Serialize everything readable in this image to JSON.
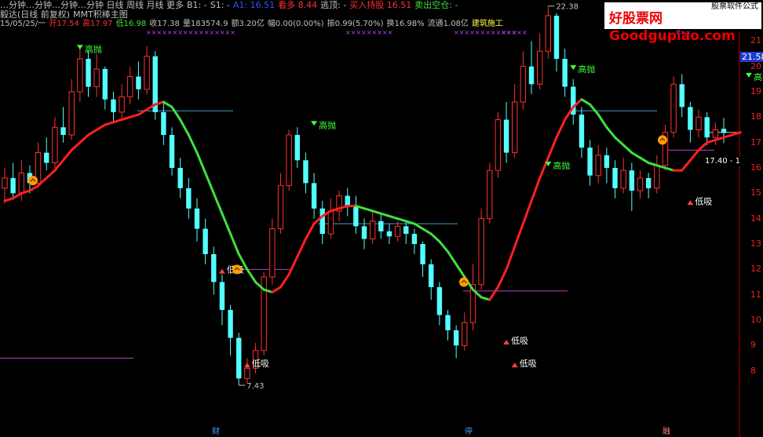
{
  "header": {
    "line1": [
      {
        "text": "…分钟…分钟…分钟…分钟 日线 周线 月线 更多",
        "color": "#c0c0c0"
      },
      {
        "text": "B1: -",
        "color": "#c0c0c0"
      },
      {
        "text": "S1: -",
        "color": "#c0c0c0"
      },
      {
        "text": "A1: 16.51",
        "color": "#3050ff"
      },
      {
        "text": "看多  8.44",
        "color": "#ff3030"
      },
      {
        "text": "逃顶: -",
        "color": "#c0c0c0"
      },
      {
        "text": "买入持股  16.51",
        "color": "#ff3030"
      },
      {
        "text": "卖出空仓: -",
        "color": "#40e040"
      }
    ],
    "title_line": [
      {
        "text": "毅达(日线 前复权)",
        "color": "#c0c0c0"
      },
      {
        "text": "MMT积棒主图",
        "color": "#c0c0c0"
      }
    ],
    "info_line": [
      {
        "text": "15/05/25/一",
        "color": "#c0c0c0"
      },
      {
        "text": "开17.54",
        "color": "#ff3030"
      },
      {
        "text": "高17.97",
        "color": "#ff3030"
      },
      {
        "text": "低16.98",
        "color": "#40e040"
      },
      {
        "text": "收17.38",
        "color": "#c0c0c0"
      },
      {
        "text": "量183574.9",
        "color": "#c0c0c0"
      },
      {
        "text": "额3.20亿",
        "color": "#c0c0c0"
      },
      {
        "text": "幅0.00(0.00%)",
        "color": "#c0c0c0"
      },
      {
        "text": "振0.99(5.70%)",
        "color": "#c0c0c0"
      },
      {
        "text": "换16.98%",
        "color": "#c0c0c0"
      },
      {
        "text": "流通1.08亿",
        "color": "#c0c0c0"
      },
      {
        "text": "建筑施工",
        "color": "#ffff40"
      }
    ],
    "x_marks": [
      "×××××××××××××××××",
      "×××××××××",
      "××××××××××××",
      "×××××",
      "×××"
    ]
  },
  "watermark": {
    "main": "好股票网Goodgupiao.com",
    "sub": "股票软件公式"
  },
  "axis": {
    "price_box": "21.58",
    "ticks": [
      "21",
      "20",
      "19",
      "18",
      "17",
      "16",
      "15",
      "14",
      "13",
      "12",
      "11",
      "10",
      "9",
      "8"
    ]
  },
  "current_price_label": "17.40 - 1",
  "annotations": {
    "high": "22.38",
    "low": "7.43",
    "gaopao": "高抛",
    "dixi": "低吸"
  },
  "bottom_tags": [
    "财",
    "停",
    "融"
  ],
  "colors": {
    "up": "#ff3030",
    "down": "#54ffff",
    "ma_up": "#ff2020",
    "ma_down": "#40e040",
    "level_cyan": "#40a0c0",
    "level_magenta": "#c040c0",
    "axis": "#c00000"
  },
  "chart_data": {
    "type": "candlestick",
    "ylim": [
      7,
      22
    ],
    "labeled_extremes": {
      "high": 22.38,
      "low": 7.43
    },
    "candles": [
      {
        "o": 15.2,
        "c": 15.6,
        "h": 16.0,
        "l": 14.6
      },
      {
        "o": 15.6,
        "c": 15.0,
        "h": 16.2,
        "l": 14.8
      },
      {
        "o": 15.0,
        "c": 15.8,
        "h": 16.3,
        "l": 14.7
      },
      {
        "o": 15.8,
        "c": 15.4,
        "h": 16.1,
        "l": 15.0
      },
      {
        "o": 15.4,
        "c": 16.6,
        "h": 17.0,
        "l": 15.2
      },
      {
        "o": 16.6,
        "c": 16.2,
        "h": 17.2,
        "l": 15.9
      },
      {
        "o": 16.2,
        "c": 17.6,
        "h": 18.0,
        "l": 16.0
      },
      {
        "o": 17.6,
        "c": 17.3,
        "h": 18.4,
        "l": 17.0
      },
      {
        "o": 17.3,
        "c": 19.0,
        "h": 19.5,
        "l": 17.1
      },
      {
        "o": 19.0,
        "c": 20.3,
        "h": 20.7,
        "l": 18.6
      },
      {
        "o": 20.3,
        "c": 19.2,
        "h": 20.6,
        "l": 18.8
      },
      {
        "o": 19.2,
        "c": 19.9,
        "h": 20.5,
        "l": 18.8
      },
      {
        "o": 19.9,
        "c": 18.7,
        "h": 20.0,
        "l": 18.3
      },
      {
        "o": 18.7,
        "c": 18.2,
        "h": 19.0,
        "l": 17.8
      },
      {
        "o": 18.2,
        "c": 18.8,
        "h": 19.3,
        "l": 17.9
      },
      {
        "o": 18.8,
        "c": 19.6,
        "h": 20.0,
        "l": 18.5
      },
      {
        "o": 19.6,
        "c": 19.1,
        "h": 20.2,
        "l": 18.7
      },
      {
        "o": 19.1,
        "c": 20.4,
        "h": 20.8,
        "l": 18.9
      },
      {
        "o": 20.4,
        "c": 18.2,
        "h": 20.6,
        "l": 17.9
      },
      {
        "o": 18.2,
        "c": 17.3,
        "h": 18.6,
        "l": 16.9
      },
      {
        "o": 17.3,
        "c": 16.0,
        "h": 17.6,
        "l": 15.7
      },
      {
        "o": 16.0,
        "c": 15.2,
        "h": 16.4,
        "l": 14.8
      },
      {
        "o": 15.2,
        "c": 14.4,
        "h": 15.6,
        "l": 14.0
      },
      {
        "o": 14.4,
        "c": 13.6,
        "h": 14.8,
        "l": 13.1
      },
      {
        "o": 13.6,
        "c": 12.6,
        "h": 14.0,
        "l": 12.2
      },
      {
        "o": 12.6,
        "c": 11.5,
        "h": 12.9,
        "l": 11.0
      },
      {
        "o": 11.5,
        "c": 10.4,
        "h": 11.8,
        "l": 9.8
      },
      {
        "o": 10.4,
        "c": 9.3,
        "h": 10.6,
        "l": 8.6
      },
      {
        "o": 9.3,
        "c": 7.7,
        "h": 9.5,
        "l": 7.43
      },
      {
        "o": 7.7,
        "c": 8.1,
        "h": 8.5,
        "l": 7.5
      },
      {
        "o": 8.1,
        "c": 8.8,
        "h": 9.1,
        "l": 7.9
      },
      {
        "o": 8.8,
        "c": 11.7,
        "h": 11.9,
        "l": 8.6
      },
      {
        "o": 11.7,
        "c": 13.6,
        "h": 14.0,
        "l": 11.4
      },
      {
        "o": 13.6,
        "c": 15.3,
        "h": 15.8,
        "l": 13.4
      },
      {
        "o": 15.3,
        "c": 17.3,
        "h": 17.5,
        "l": 15.1
      },
      {
        "o": 17.3,
        "c": 16.3,
        "h": 17.6,
        "l": 16.0
      },
      {
        "o": 16.3,
        "c": 15.4,
        "h": 16.6,
        "l": 15.0
      },
      {
        "o": 15.4,
        "c": 14.4,
        "h": 15.8,
        "l": 14.0
      },
      {
        "o": 14.4,
        "c": 13.4,
        "h": 14.7,
        "l": 13.0
      },
      {
        "o": 13.4,
        "c": 14.3,
        "h": 14.8,
        "l": 13.2
      },
      {
        "o": 14.3,
        "c": 14.9,
        "h": 15.1,
        "l": 13.9
      },
      {
        "o": 14.9,
        "c": 14.5,
        "h": 15.2,
        "l": 14.1
      },
      {
        "o": 14.5,
        "c": 13.7,
        "h": 14.9,
        "l": 13.4
      },
      {
        "o": 13.7,
        "c": 13.2,
        "h": 14.0,
        "l": 12.8
      },
      {
        "o": 13.2,
        "c": 13.9,
        "h": 14.3,
        "l": 13.0
      },
      {
        "o": 13.9,
        "c": 13.5,
        "h": 14.2,
        "l": 13.2
      },
      {
        "o": 13.5,
        "c": 13.3,
        "h": 13.8,
        "l": 13.0
      },
      {
        "o": 13.3,
        "c": 13.7,
        "h": 13.9,
        "l": 13.1
      },
      {
        "o": 13.7,
        "c": 13.4,
        "h": 13.9,
        "l": 13.0
      },
      {
        "o": 13.4,
        "c": 13.0,
        "h": 13.6,
        "l": 12.6
      },
      {
        "o": 13.0,
        "c": 12.2,
        "h": 13.1,
        "l": 11.7
      },
      {
        "o": 12.2,
        "c": 11.3,
        "h": 12.4,
        "l": 10.8
      },
      {
        "o": 11.3,
        "c": 10.2,
        "h": 11.5,
        "l": 9.8
      },
      {
        "o": 10.2,
        "c": 9.6,
        "h": 10.4,
        "l": 9.2
      },
      {
        "o": 9.6,
        "c": 9.0,
        "h": 9.8,
        "l": 8.5
      },
      {
        "o": 9.0,
        "c": 9.9,
        "h": 10.3,
        "l": 8.8
      },
      {
        "o": 9.9,
        "c": 11.4,
        "h": 12.2,
        "l": 9.6
      },
      {
        "o": 11.4,
        "c": 14.0,
        "h": 14.4,
        "l": 11.2
      },
      {
        "o": 14.0,
        "c": 15.9,
        "h": 16.2,
        "l": 13.8
      },
      {
        "o": 15.9,
        "c": 17.9,
        "h": 18.2,
        "l": 15.6
      },
      {
        "o": 17.9,
        "c": 16.6,
        "h": 18.6,
        "l": 16.2
      },
      {
        "o": 16.6,
        "c": 18.6,
        "h": 19.3,
        "l": 16.4
      },
      {
        "o": 18.6,
        "c": 20.0,
        "h": 20.6,
        "l": 18.3
      },
      {
        "o": 20.0,
        "c": 19.3,
        "h": 21.0,
        "l": 18.9
      },
      {
        "o": 19.3,
        "c": 20.6,
        "h": 21.3,
        "l": 19.1
      },
      {
        "o": 20.6,
        "c": 22.0,
        "h": 22.38,
        "l": 20.3
      },
      {
        "o": 22.0,
        "c": 20.3,
        "h": 22.1,
        "l": 19.8
      },
      {
        "o": 20.3,
        "c": 19.2,
        "h": 20.7,
        "l": 18.8
      },
      {
        "o": 19.2,
        "c": 18.1,
        "h": 19.5,
        "l": 17.7
      },
      {
        "o": 18.1,
        "c": 16.8,
        "h": 18.4,
        "l": 16.4
      },
      {
        "o": 16.8,
        "c": 15.7,
        "h": 17.1,
        "l": 15.3
      },
      {
        "o": 15.7,
        "c": 16.5,
        "h": 16.9,
        "l": 15.4
      },
      {
        "o": 16.5,
        "c": 16.0,
        "h": 16.8,
        "l": 15.4
      },
      {
        "o": 16.0,
        "c": 15.2,
        "h": 16.3,
        "l": 14.8
      },
      {
        "o": 15.2,
        "c": 15.9,
        "h": 16.4,
        "l": 15.0
      },
      {
        "o": 15.9,
        "c": 15.1,
        "h": 16.2,
        "l": 14.3
      },
      {
        "o": 15.1,
        "c": 15.6,
        "h": 15.9,
        "l": 14.8
      },
      {
        "o": 15.6,
        "c": 15.2,
        "h": 15.8,
        "l": 14.8
      },
      {
        "o": 15.2,
        "c": 16.1,
        "h": 16.5,
        "l": 15.0
      },
      {
        "o": 16.1,
        "c": 17.4,
        "h": 17.7,
        "l": 15.9
      },
      {
        "o": 17.4,
        "c": 19.3,
        "h": 19.6,
        "l": 17.2
      },
      {
        "o": 19.3,
        "c": 18.4,
        "h": 19.7,
        "l": 18.0
      },
      {
        "o": 18.4,
        "c": 17.5,
        "h": 18.6,
        "l": 17.0
      },
      {
        "o": 17.5,
        "c": 18.0,
        "h": 18.3,
        "l": 17.2
      },
      {
        "o": 18.0,
        "c": 17.2,
        "h": 18.2,
        "l": 16.9
      },
      {
        "o": 17.2,
        "c": 17.5,
        "h": 17.8,
        "l": 16.9
      },
      {
        "o": 17.54,
        "c": 17.38,
        "h": 17.97,
        "l": 16.98
      }
    ],
    "ma": [
      14.7,
      14.8,
      15.0,
      15.1,
      15.3,
      15.6,
      15.9,
      16.3,
      16.7,
      17.0,
      17.3,
      17.5,
      17.7,
      17.8,
      17.9,
      18.0,
      18.1,
      18.3,
      18.5,
      18.6,
      18.4,
      17.9,
      17.3,
      16.6,
      15.8,
      15.0,
      14.2,
      13.4,
      12.6,
      12.0,
      11.5,
      11.2,
      11.1,
      11.3,
      11.8,
      12.5,
      13.2,
      13.8,
      14.1,
      14.3,
      14.4,
      14.5,
      14.5,
      14.4,
      14.3,
      14.2,
      14.1,
      14.0,
      13.9,
      13.8,
      13.6,
      13.4,
      13.1,
      12.7,
      12.2,
      11.7,
      11.2,
      10.9,
      10.8,
      11.3,
      12.0,
      12.9,
      13.8,
      14.7,
      15.6,
      16.4,
      17.2,
      17.9,
      18.4,
      18.7,
      18.5,
      18.1,
      17.6,
      17.2,
      16.9,
      16.6,
      16.4,
      16.2,
      16.1,
      16.0,
      15.9,
      15.9,
      16.3,
      16.7,
      17.0,
      17.1,
      17.2,
      17.3,
      17.4
    ]
  }
}
